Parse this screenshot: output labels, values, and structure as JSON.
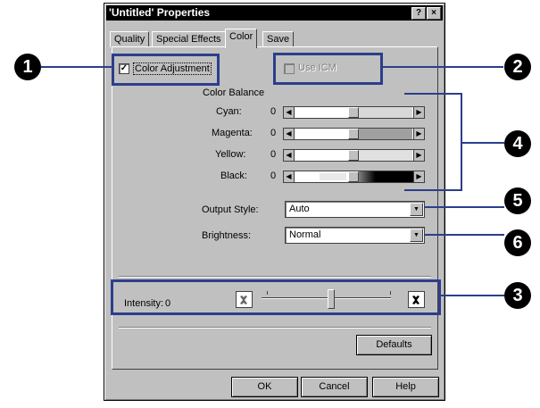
{
  "dialog": {
    "title": "'Untitled' Properties",
    "help_btn": "?",
    "close_btn": "×"
  },
  "tabs": [
    {
      "label": "Quality"
    },
    {
      "label": "Special Effects"
    },
    {
      "label": "Color",
      "active": true
    },
    {
      "label": "Save"
    }
  ],
  "color_adjustment": {
    "label": "Color Adjustment",
    "checked": true,
    "check_mark": "✓"
  },
  "use_icm": {
    "label": "Use ICM",
    "checked": false
  },
  "color_balance": {
    "title": "Color Balance",
    "channels": [
      {
        "label": "Cyan:",
        "value": "0"
      },
      {
        "label": "Magenta:",
        "value": "0"
      },
      {
        "label": "Yellow:",
        "value": "0"
      },
      {
        "label": "Black:",
        "value": "0"
      }
    ]
  },
  "output_style": {
    "label": "Output Style:",
    "value": "Auto"
  },
  "brightness": {
    "label": "Brightness:",
    "value": "Normal"
  },
  "intensity": {
    "label": "Intensity:",
    "value": "0"
  },
  "buttons": {
    "defaults": "Defaults",
    "ok": "OK",
    "cancel": "Cancel",
    "help": "Help"
  },
  "callouts": [
    "1",
    "2",
    "3",
    "4",
    "5",
    "6"
  ],
  "colors": {
    "highlight": "#2c3e8c",
    "dialog_bg": "#c0c0c0"
  }
}
